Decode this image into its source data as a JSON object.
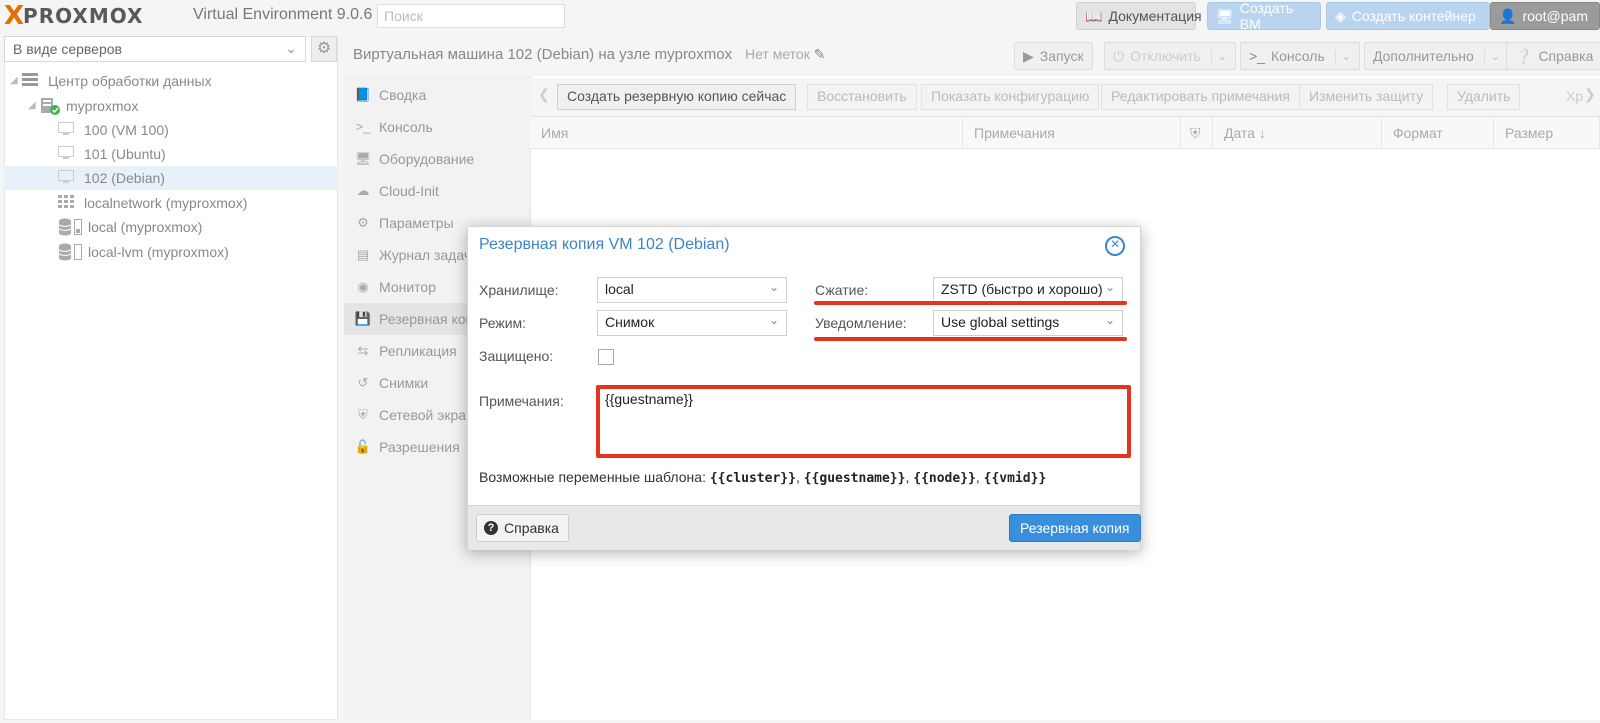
{
  "header": {
    "logo_x": "X",
    "logo_text": "PROXMOX",
    "version": "Virtual Environment 9.0.6",
    "search_placeholder": "Поиск",
    "docs_label": "Документация",
    "create_vm_label": "Создать ВМ",
    "create_ct_label": "Создать контейнер",
    "user_label": "root@pam"
  },
  "sidebar": {
    "view_select": "В виде серверов",
    "tree": [
      {
        "label": "Центр обработки данных",
        "icon": "datacenter-icon"
      },
      {
        "label": "myproxmox",
        "icon": "node-icon"
      },
      {
        "label": "100 (VM 100)",
        "icon": "vm-icon"
      },
      {
        "label": "101 (Ubuntu)",
        "icon": "vm-icon"
      },
      {
        "label": "102 (Debian)",
        "icon": "vm-icon"
      },
      {
        "label": "localnetwork (myproxmox)",
        "icon": "network-icon"
      },
      {
        "label": "local (myproxmox)",
        "icon": "storage-icon"
      },
      {
        "label": "local-lvm (myproxmox)",
        "icon": "storage-icon"
      }
    ]
  },
  "main": {
    "title": "Виртуальная машина 102 (Debian) на узле myproxmox",
    "tags": "Нет меток",
    "toolbar": {
      "start": "Запуск",
      "shutdown": "Отключить",
      "console": "Консоль",
      "more": "Дополнительно",
      "help": "Справка"
    },
    "nav": [
      {
        "label": "Сводка",
        "icon": "book-icon"
      },
      {
        "label": "Консоль",
        "icon": "terminal-icon"
      },
      {
        "label": "Оборудование",
        "icon": "monitor-icon"
      },
      {
        "label": "Cloud-Init",
        "icon": "cloud-icon"
      },
      {
        "label": "Параметры",
        "icon": "gear-icon"
      },
      {
        "label": "Журнал задач",
        "icon": "list-icon"
      },
      {
        "label": "Монитор",
        "icon": "eye-icon"
      },
      {
        "label": "Резервная копия",
        "icon": "floppy-icon"
      },
      {
        "label": "Репликация",
        "icon": "retweet-icon"
      },
      {
        "label": "Снимки",
        "icon": "history-icon"
      },
      {
        "label": "Сетевой экран",
        "icon": "shield-icon"
      },
      {
        "label": "Разрешения",
        "icon": "unlock-icon"
      }
    ],
    "subtoolbar": {
      "backup_now": "Создать резервную копию сейчас",
      "restore": "Восстановить",
      "show_config": "Показать конфигурацию",
      "edit_notes": "Редактировать примечания",
      "change_protection": "Изменить защиту",
      "delete": "Удалить",
      "storage_trunc": "Хр"
    },
    "columns": {
      "name": "Имя",
      "notes": "Примечания",
      "date": "Дата",
      "format": "Формат",
      "size": "Размер"
    }
  },
  "dialog": {
    "title": "Резервная копия VM 102 (Debian)",
    "storage_label": "Хранилище:",
    "storage_value": "local",
    "mode_label": "Режим:",
    "mode_value": "Снимок",
    "protected_label": "Защищено:",
    "compression_label": "Сжатие:",
    "compression_value": "ZSTD (быстро и хорошо)",
    "notification_label": "Уведомление:",
    "notification_value": "Use global settings",
    "notes_label": "Примечания:",
    "notes_value": "{{guestname}}",
    "vars_prefix": "Возможные переменные шаблона:",
    "vars": [
      "{{cluster}}",
      "{{guestname}}",
      "{{node}}",
      "{{vmid}}"
    ],
    "help_label": "Справка",
    "submit_label": "Резервная копия"
  },
  "colors": {
    "accent": "#3a8fdd",
    "highlight_red": "#e5341d",
    "logo_orange": "#e57000"
  }
}
